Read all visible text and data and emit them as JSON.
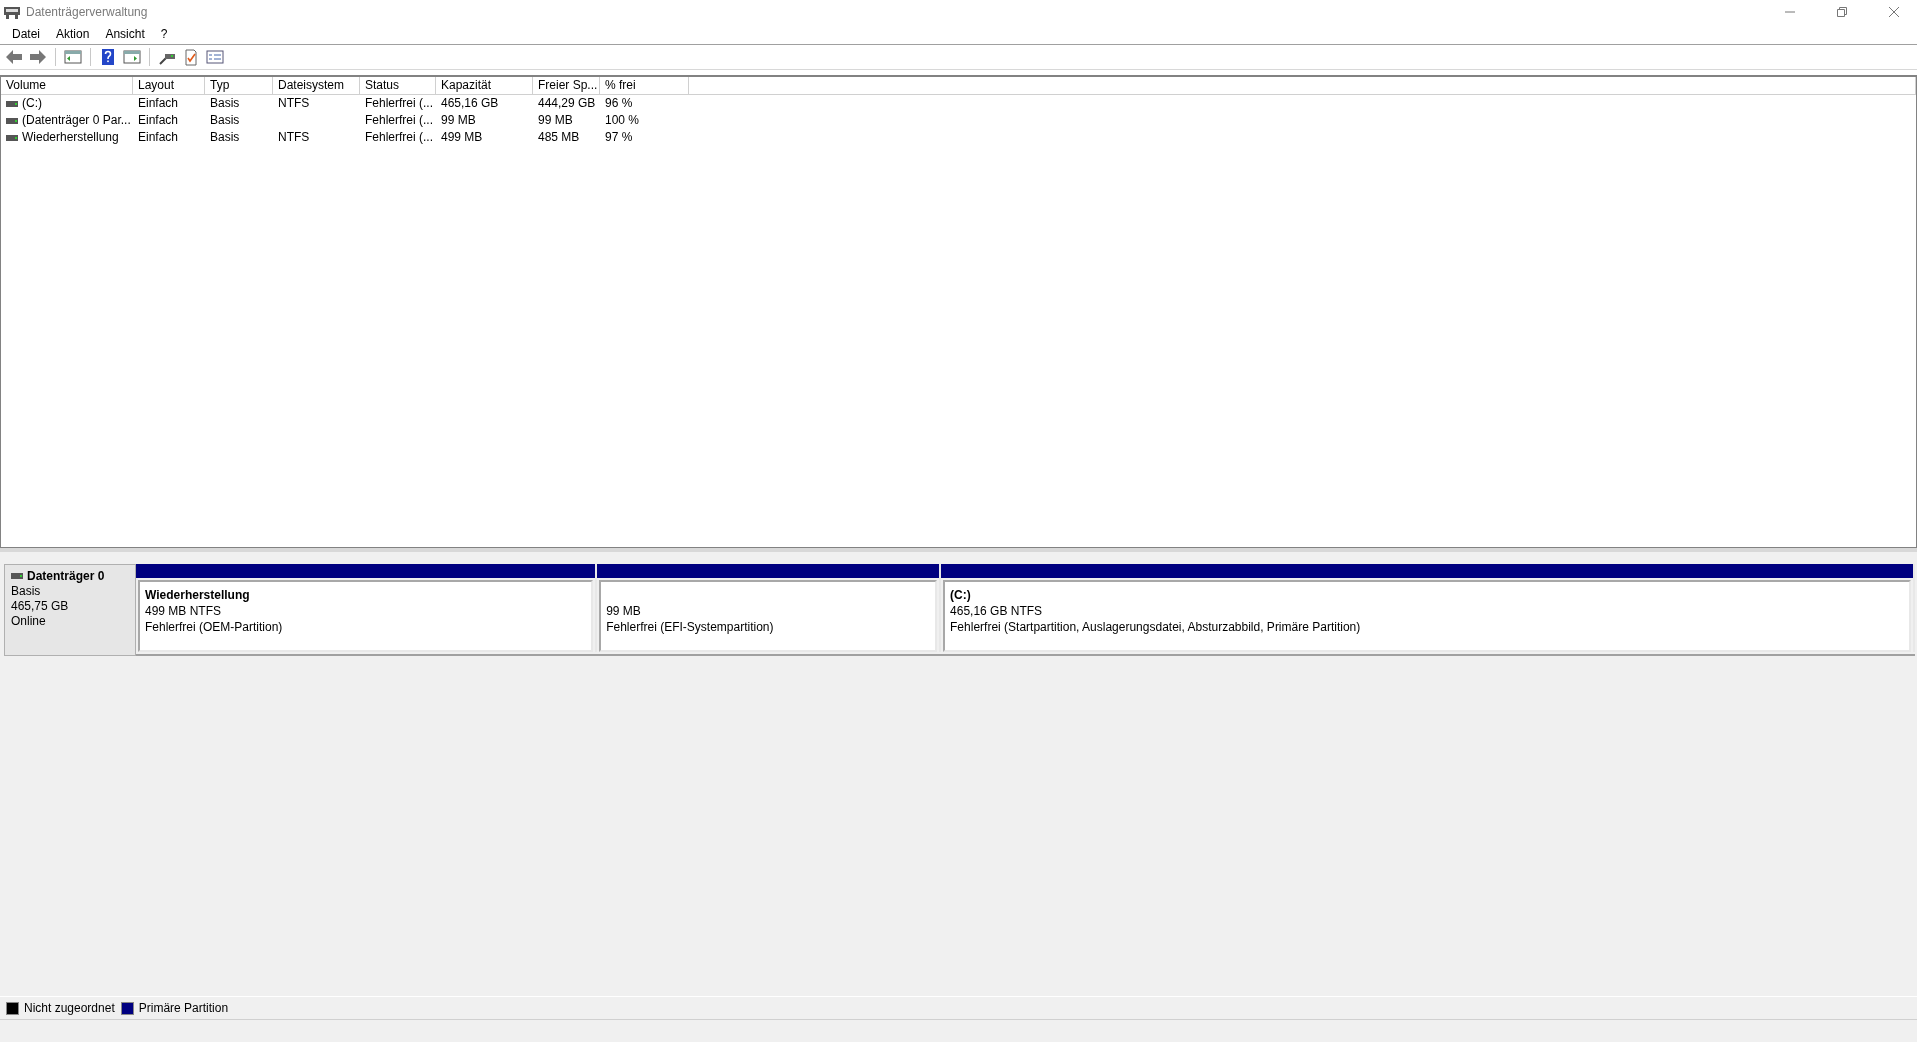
{
  "window": {
    "title": "Datenträgerverwaltung"
  },
  "menu": [
    "Datei",
    "Aktion",
    "Ansicht",
    "?"
  ],
  "volume_list": {
    "columns": [
      "Volume",
      "Layout",
      "Typ",
      "Dateisystem",
      "Status",
      "Kapazität",
      "Freier Sp...",
      "% frei"
    ],
    "rows": [
      [
        "(C:)",
        "Einfach",
        "Basis",
        "NTFS",
        "Fehlerfrei (...",
        "465,16 GB",
        "444,29 GB",
        "96 %"
      ],
      [
        "(Datenträger 0 Par...",
        "Einfach",
        "Basis",
        "",
        "Fehlerfrei (...",
        "99 MB",
        "99 MB",
        "100 %"
      ],
      [
        "Wiederherstellung",
        "Einfach",
        "Basis",
        "NTFS",
        "Fehlerfrei (...",
        "499 MB",
        "485 MB",
        "97 %"
      ]
    ]
  },
  "disk": {
    "name": "Datenträger 0",
    "type": "Basis",
    "size": "465,75 GB",
    "state": "Online",
    "partitions": [
      {
        "name": "Wiederherstellung",
        "size": "499 MB NTFS",
        "status": "Fehlerfrei (OEM-Partition)",
        "color": "#000080"
      },
      {
        "size": "99 MB",
        "status": "Fehlerfrei (EFI-Systempartition)",
        "color": "#000080"
      },
      {
        "name": "(C:)",
        "size": "465,16 GB NTFS",
        "status": "Fehlerfrei (Startpartition, Auslagerungsdatei, Absturzabbild, Primäre Partition)",
        "color": "#000080"
      }
    ]
  },
  "legend": [
    {
      "label": "Nicht zugeordnet",
      "color": "#000000"
    },
    {
      "label": "Primäre Partition",
      "color": "#000080"
    }
  ]
}
